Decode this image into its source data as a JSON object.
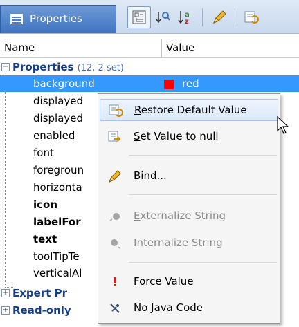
{
  "header": {
    "tab_label": "Properties",
    "toolbar": [
      {
        "icon": "tree-view-icon",
        "glyph": "⊟",
        "selected": true
      },
      {
        "icon": "sort-by-category-icon",
        "glyph": "↓⁹"
      },
      {
        "icon": "sort-alphabetical-icon",
        "glyph": "↓a"
      },
      {
        "icon": "pencil-bind-icon",
        "glyph": "✎"
      },
      {
        "icon": "restore-default-icon",
        "glyph": "⟲"
      }
    ]
  },
  "columns": {
    "name": "Name",
    "value": "Value"
  },
  "group": {
    "label": "Properties",
    "count": "(12, 2 set)"
  },
  "rows": [
    {
      "name": "background",
      "value": "red"
    },
    {
      "name": "displayed"
    },
    {
      "name": "displayed"
    },
    {
      "name": "enabled"
    },
    {
      "name": "font"
    },
    {
      "name": "foregroun"
    },
    {
      "name": "horizonta"
    },
    {
      "name": "icon"
    },
    {
      "name": "labelFor"
    },
    {
      "name": "text"
    },
    {
      "name": "toolTipTe"
    },
    {
      "name": "verticalAl"
    }
  ],
  "groups_below": [
    {
      "label": "Expert Pr"
    },
    {
      "label": "Read-only"
    }
  ],
  "menu": [
    {
      "label": "Restore Default Value",
      "mnemonic": "R",
      "rest": "estore Default Value",
      "icon": "restore-default-icon"
    },
    {
      "label": "Set Value to null",
      "mnemonic": "S",
      "rest": "et Value to null",
      "icon": "set-null-icon"
    },
    {
      "label": "Bind...",
      "mnemonic": "B",
      "rest": "ind...",
      "icon": "bind-icon"
    },
    {
      "label": "Externalize String",
      "mnemonic": "E",
      "rest": "xternalize String",
      "icon": "externalize-icon"
    },
    {
      "label": "Internalize String",
      "mnemonic": "I",
      "rest": "nternalize String",
      "icon": "internalize-icon"
    },
    {
      "label": "Force Value",
      "mnemonic": "F",
      "rest": "orce Value",
      "icon": "force-value-icon"
    },
    {
      "label": "No Java Code",
      "mnemonic": "N",
      "rest": "o Java Code",
      "icon": "no-java-code-icon"
    }
  ],
  "colors": {
    "selection": "#3399ff",
    "swatch": "#ff0000",
    "tab": "#4a7ec8"
  }
}
